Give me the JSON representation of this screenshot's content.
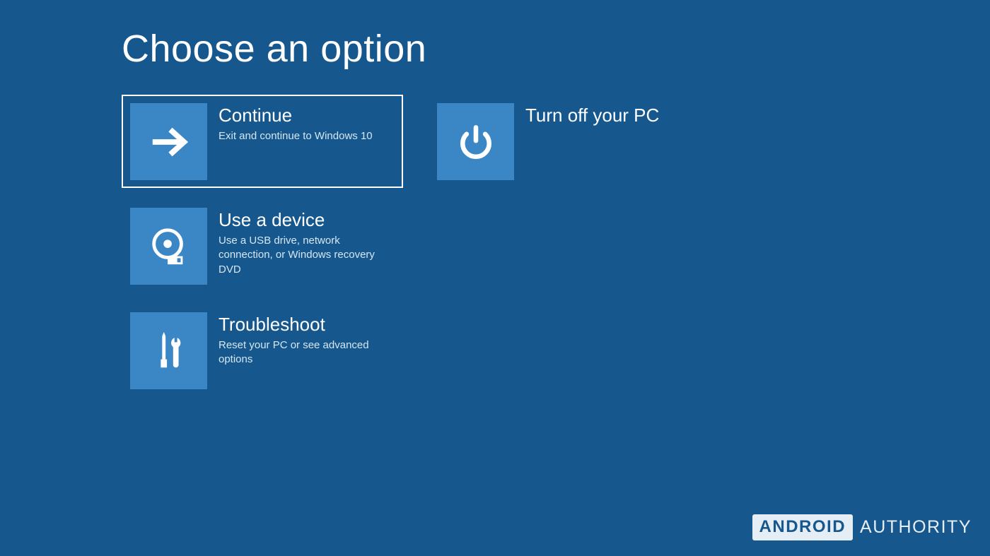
{
  "title": "Choose an option",
  "options": {
    "continue": {
      "label": "Continue",
      "desc": "Exit and continue to Windows 10",
      "selected": true
    },
    "use_device": {
      "label": "Use a device",
      "desc": "Use a USB drive, network connection, or Windows recovery DVD",
      "selected": false
    },
    "troubleshoot": {
      "label": "Troubleshoot",
      "desc": "Reset your PC or see advanced options",
      "selected": false
    },
    "turn_off": {
      "label": "Turn off your PC",
      "desc": "",
      "selected": false
    }
  },
  "watermark": {
    "box": "ANDROID",
    "word": "AUTHORITY"
  },
  "colors": {
    "background": "#16588e",
    "tile": "#3b86c4"
  }
}
